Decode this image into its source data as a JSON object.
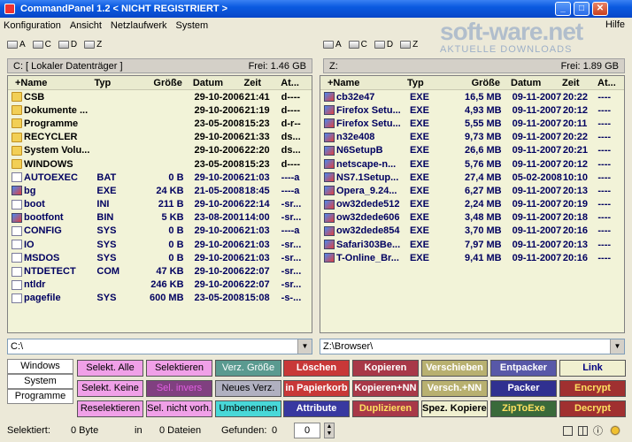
{
  "window": {
    "title": "CommandPanel 1.2  < NICHT REGISTRIERT >"
  },
  "menu": [
    "Konfiguration",
    "Ansicht",
    "Netzlaufwerk",
    "System"
  ],
  "help": "Hilfe",
  "watermark": {
    "line1": "soft-ware.net",
    "line2": "AKTUELLE DOWNLOADS"
  },
  "drives": {
    "a": "A",
    "c": "C",
    "d": "D",
    "z": "Z"
  },
  "left": {
    "path": "C:  [ Lokaler Datenträger ]",
    "free": "Frei:  1.46 GB",
    "headers": [
      "+Name",
      "Typ",
      "Größe",
      "Datum",
      "Zeit",
      "At..."
    ],
    "rows": [
      {
        "icon": "folder",
        "name": "CSB",
        "type": "",
        "size": "",
        "date": "29-10-2006",
        "time": "21:41",
        "attr": "d----"
      },
      {
        "icon": "folder",
        "name": "Dokumente ...",
        "type": "",
        "size": "",
        "date": "29-10-2006",
        "time": "21:19",
        "attr": "d----"
      },
      {
        "icon": "folder",
        "name": "Programme",
        "type": "",
        "size": "",
        "date": "23-05-2008",
        "time": "15:23",
        "attr": "d-r--"
      },
      {
        "icon": "folder",
        "name": "RECYCLER",
        "type": "",
        "size": "",
        "date": "29-10-2006",
        "time": "21:33",
        "attr": "ds..."
      },
      {
        "icon": "folder",
        "name": "System Volu...",
        "type": "",
        "size": "",
        "date": "29-10-2006",
        "time": "22:20",
        "attr": "ds..."
      },
      {
        "icon": "folder",
        "name": "WINDOWS",
        "type": "",
        "size": "",
        "date": "23-05-2008",
        "time": "15:23",
        "attr": "d----"
      },
      {
        "icon": "file",
        "name": "AUTOEXEC",
        "type": "BAT",
        "size": "0 B",
        "date": "29-10-2006",
        "time": "21:03",
        "attr": "----a"
      },
      {
        "icon": "exe",
        "name": "bg",
        "type": "EXE",
        "size": "24 KB",
        "date": "21-05-2008",
        "time": "18:45",
        "attr": "----a"
      },
      {
        "icon": "file",
        "name": "boot",
        "type": "INI",
        "size": "211 B",
        "date": "29-10-2006",
        "time": "22:14",
        "attr": "-sr..."
      },
      {
        "icon": "exe",
        "name": "bootfont",
        "type": "BIN",
        "size": "5 KB",
        "date": "23-08-2001",
        "time": "14:00",
        "attr": "-sr..."
      },
      {
        "icon": "file",
        "name": "CONFIG",
        "type": "SYS",
        "size": "0 B",
        "date": "29-10-2006",
        "time": "21:03",
        "attr": "----a"
      },
      {
        "icon": "file",
        "name": "IO",
        "type": "SYS",
        "size": "0 B",
        "date": "29-10-2006",
        "time": "21:03",
        "attr": "-sr..."
      },
      {
        "icon": "file",
        "name": "MSDOS",
        "type": "SYS",
        "size": "0 B",
        "date": "29-10-2006",
        "time": "21:03",
        "attr": "-sr..."
      },
      {
        "icon": "file",
        "name": "NTDETECT",
        "type": "COM",
        "size": "47 KB",
        "date": "29-10-2006",
        "time": "22:07",
        "attr": "-sr..."
      },
      {
        "icon": "file",
        "name": "ntldr",
        "type": "",
        "size": "246 KB",
        "date": "29-10-2006",
        "time": "22:07",
        "attr": "-sr..."
      },
      {
        "icon": "file",
        "name": "pagefile",
        "type": "SYS",
        "size": "600 MB",
        "date": "23-05-2008",
        "time": "15:08",
        "attr": "-s-..."
      }
    ],
    "cmd": "C:\\"
  },
  "right": {
    "path": "Z:",
    "free": "Frei:  1.89 GB",
    "headers": [
      "+Name",
      "Typ",
      "Größe",
      "Datum",
      "Zeit",
      "At..."
    ],
    "rows": [
      {
        "icon": "exe",
        "name": "cb32e47",
        "type": "EXE",
        "size": "16,5 MB",
        "date": "09-11-2007",
        "time": "20:22",
        "attr": "----"
      },
      {
        "icon": "exe",
        "name": "Firefox Setu...",
        "type": "EXE",
        "size": "4,93 MB",
        "date": "09-11-2007",
        "time": "20:12",
        "attr": "----"
      },
      {
        "icon": "exe",
        "name": "Firefox Setu...",
        "type": "EXE",
        "size": "5,55 MB",
        "date": "09-11-2007",
        "time": "20:11",
        "attr": "----"
      },
      {
        "icon": "exe",
        "name": "n32e408",
        "type": "EXE",
        "size": "9,73 MB",
        "date": "09-11-2007",
        "time": "20:22",
        "attr": "----"
      },
      {
        "icon": "exe",
        "name": "N6SetupB",
        "type": "EXE",
        "size": "26,6 MB",
        "date": "09-11-2007",
        "time": "20:21",
        "attr": "----"
      },
      {
        "icon": "exe",
        "name": "netscape-n...",
        "type": "EXE",
        "size": "5,76 MB",
        "date": "09-11-2007",
        "time": "20:12",
        "attr": "----"
      },
      {
        "icon": "exe",
        "name": "NS7.1Setup...",
        "type": "EXE",
        "size": "27,4 MB",
        "date": "05-02-2008",
        "time": "10:10",
        "attr": "----"
      },
      {
        "icon": "exe",
        "name": "Opera_9.24...",
        "type": "EXE",
        "size": "6,27 MB",
        "date": "09-11-2007",
        "time": "20:13",
        "attr": "----"
      },
      {
        "icon": "exe",
        "name": "ow32dede512",
        "type": "EXE",
        "size": "2,24 MB",
        "date": "09-11-2007",
        "time": "20:19",
        "attr": "----"
      },
      {
        "icon": "exe",
        "name": "ow32dede606",
        "type": "EXE",
        "size": "3,48 MB",
        "date": "09-11-2007",
        "time": "20:18",
        "attr": "----"
      },
      {
        "icon": "exe",
        "name": "ow32dede854",
        "type": "EXE",
        "size": "3,70 MB",
        "date": "09-11-2007",
        "time": "20:16",
        "attr": "----"
      },
      {
        "icon": "exe",
        "name": "Safari303Be...",
        "type": "EXE",
        "size": "7,97 MB",
        "date": "09-11-2007",
        "time": "20:13",
        "attr": "----"
      },
      {
        "icon": "exe",
        "name": "T-Online_Br...",
        "type": "EXE",
        "size": "9,41 MB",
        "date": "09-11-2007",
        "time": "20:16",
        "attr": "----"
      }
    ],
    "cmd": "Z:\\Browser\\"
  },
  "tabs": [
    "Windows",
    "System",
    "Programme"
  ],
  "buttons": [
    [
      {
        "label": "Selekt. Alle",
        "bg": "#f0a0e8",
        "fg": "#000"
      },
      {
        "label": "Selektieren",
        "bg": "#f0a0e8",
        "fg": "#000"
      },
      {
        "label": "Verz. Größe",
        "bg": "#5a9a90",
        "fg": "#fff"
      },
      {
        "label": "Löschen",
        "bg": "#c83838",
        "fg": "#fff"
      },
      {
        "label": "Kopieren",
        "bg": "#a83848",
        "fg": "#fff"
      },
      {
        "label": "Verschieben",
        "bg": "#b8b070",
        "fg": "#fff"
      },
      {
        "label": "Entpacker",
        "bg": "#5858a8",
        "fg": "#fff"
      },
      {
        "label": "Link",
        "bg": "#f0f0d0",
        "fg": "#000080"
      }
    ],
    [
      {
        "label": "Selekt. Keine",
        "bg": "#f0a0e8",
        "fg": "#000"
      },
      {
        "label": "Sel. invers",
        "bg": "#804080",
        "fg": "#e060e0"
      },
      {
        "label": "Neues Verz.",
        "bg": "#b0b0c0",
        "fg": "#000"
      },
      {
        "label": "in Papierkorb",
        "bg": "#c83838",
        "fg": "#fff"
      },
      {
        "label": "Kopieren+NN",
        "bg": "#a83848",
        "fg": "#fff"
      },
      {
        "label": "Versch.+NN",
        "bg": "#b8b070",
        "fg": "#fff"
      },
      {
        "label": "Packer",
        "bg": "#303090",
        "fg": "#fff"
      },
      {
        "label": "Encrypt",
        "bg": "#a03030",
        "fg": "#ffe060"
      }
    ],
    [
      {
        "label": "Reselektieren",
        "bg": "#f0a0e8",
        "fg": "#000"
      },
      {
        "label": "Sel. nicht vorh.",
        "bg": "#f0a0e8",
        "fg": "#000"
      },
      {
        "label": "Umbenennen",
        "bg": "#48d8d8",
        "fg": "#000"
      },
      {
        "label": "Attribute",
        "bg": "#3838a0",
        "fg": "#fff"
      },
      {
        "label": "Duplizieren",
        "bg": "#a83848",
        "fg": "#ffe060"
      },
      {
        "label": "Spez. Kopieren",
        "bg": "#f0f0d0",
        "fg": "#000"
      },
      {
        "label": "ZipToExe",
        "bg": "#3a6a3a",
        "fg": "#ffe060"
      },
      {
        "label": "Decrypt",
        "bg": "#a03030",
        "fg": "#ffe060"
      }
    ]
  ],
  "status": {
    "label1": "Selektiert:",
    "bytes": "0 Byte",
    "in": "in",
    "files": "0 Dateien",
    "found_label": "Gefunden:",
    "found": "0",
    "spin": "0"
  }
}
